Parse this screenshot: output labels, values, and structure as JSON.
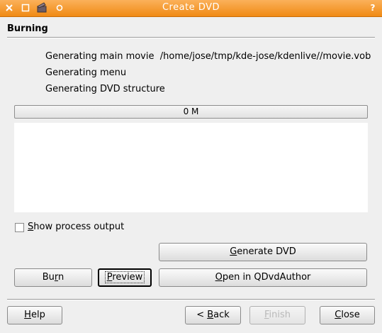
{
  "window": {
    "title": "Create DVD",
    "help_glyph": "?"
  },
  "section": {
    "title": "Burning"
  },
  "steps": [
    {
      "label": "Generating main movie",
      "path": "/home/jose/tmp/kde-jose/kdenlive//movie.vob"
    },
    {
      "label": "Generating menu"
    },
    {
      "label": "Generating DVD structure"
    }
  ],
  "progress": {
    "text": "0 M",
    "value": 0
  },
  "log": {
    "text": ""
  },
  "options": {
    "show_process_output": {
      "first": "S",
      "rest": "how process output",
      "checked": false
    }
  },
  "buttons": {
    "generate_dvd": {
      "first": "G",
      "rest": "enerate DVD"
    },
    "burn": {
      "pre": "Bu",
      "key": "r",
      "post": "n"
    },
    "preview": {
      "first": "P",
      "rest": "review"
    },
    "open_qdvdauthor": {
      "first": "O",
      "rest": "pen in QDvdAuthor"
    },
    "help": {
      "first": "H",
      "rest": "elp"
    },
    "back": {
      "pre": "< ",
      "key": "B",
      "post": "ack"
    },
    "finish": {
      "first": "F",
      "rest": "inish"
    },
    "close": {
      "first": "C",
      "rest": "lose"
    }
  },
  "icons": {
    "close": "close-x-icon",
    "maximize": "maximize-square-icon",
    "app": "kdenlive-clapper-icon",
    "sticky": "sticky-circle-icon",
    "help": "help-question-icon"
  },
  "colors": {
    "titlebar": "#f39a2e",
    "window_bg": "#efefef",
    "text": "#000000"
  }
}
